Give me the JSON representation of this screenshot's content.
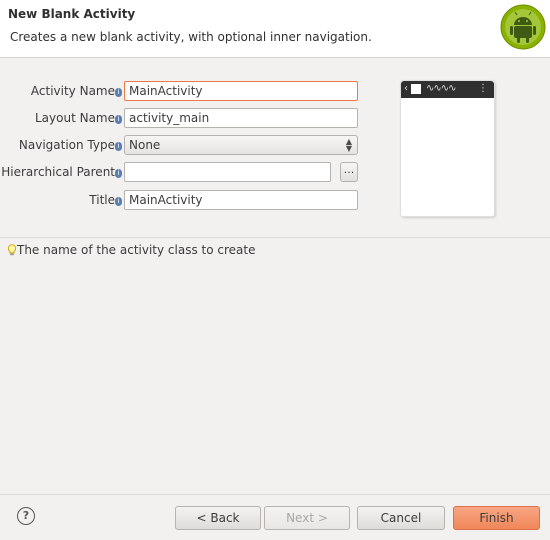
{
  "header": {
    "title": "New Blank Activity",
    "description": "Creates a new blank activity, with optional inner navigation."
  },
  "form": {
    "activity_name": {
      "label": "Activity Name",
      "value": "MainActivity"
    },
    "layout_name": {
      "label": "Layout Name",
      "value": "activity_main"
    },
    "navigation_type": {
      "label": "Navigation Type",
      "value": "None"
    },
    "hierarchical_parent": {
      "label": "Hierarchical Parent",
      "value": "",
      "browse_label": "..."
    },
    "title": {
      "label": "Title",
      "value": "MainActivity"
    }
  },
  "hint": {
    "text": "The name of the activity class to create"
  },
  "buttons": {
    "help": "?",
    "back": "< Back",
    "next": "Next >",
    "cancel": "Cancel",
    "finish": "Finish"
  },
  "colors": {
    "accent": "#f07746",
    "finish_button": "#f1875a",
    "android_green": "#8ab000"
  },
  "icons": {
    "header": "android-logo-icon",
    "hint": "lightbulb-icon",
    "info": "info-icon",
    "help": "help-icon"
  }
}
